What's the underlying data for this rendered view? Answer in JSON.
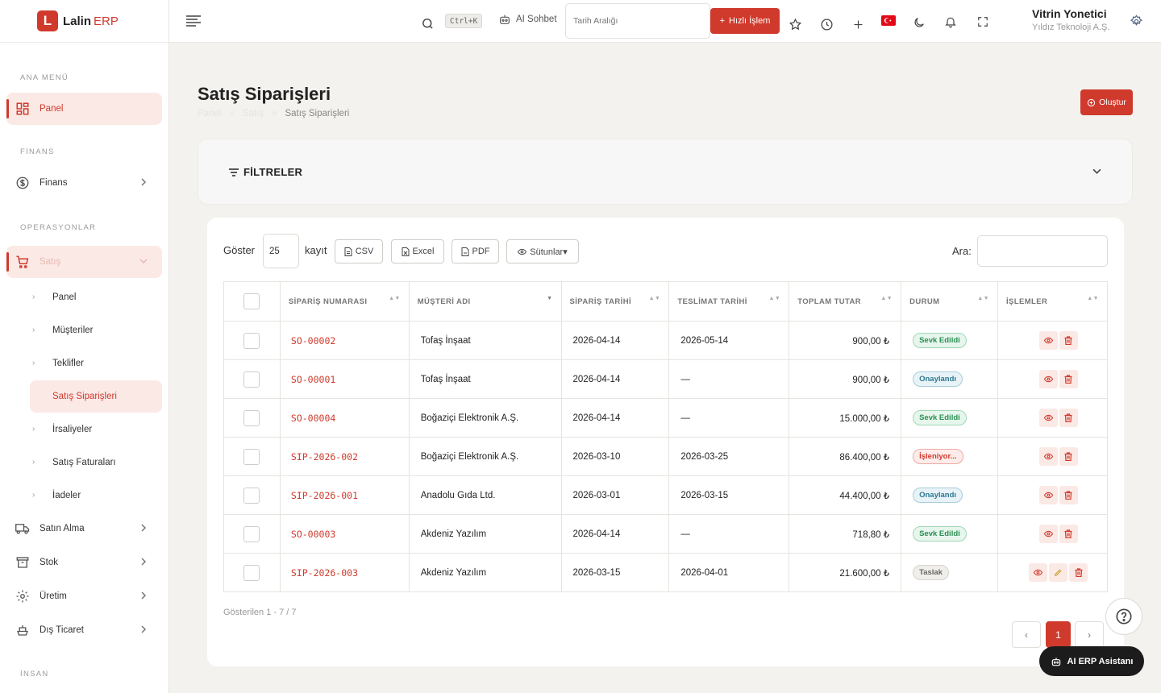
{
  "brand": {
    "logo_letter": "L",
    "name": "Lalin",
    "suffix": "ERP"
  },
  "sidebar": {
    "sections": {
      "main": "ANA MENÜ",
      "finance": "FİNANS",
      "operations": "OPERASYONLAR",
      "human": "İNSAN"
    },
    "items": {
      "panel": "Panel",
      "finance": "Finans",
      "sales": "Satış",
      "purchasing": "Satın Alma",
      "stock": "Stok",
      "production": "Üretim",
      "foreign_trade": "Dış Ticaret"
    },
    "sales_sub": [
      {
        "label": "Panel"
      },
      {
        "label": "Müşteriler"
      },
      {
        "label": "Teklifler"
      },
      {
        "label": "Satış Siparişleri"
      },
      {
        "label": "İrsaliyeler"
      },
      {
        "label": "Satış Faturaları"
      },
      {
        "label": "İadeler"
      }
    ]
  },
  "topbar": {
    "shortcut": "Ctrl+K",
    "ai_chat": "AI Sohbet",
    "date_placeholder": "Tarih Aralığı",
    "quick_action": "Hızlı İşlem",
    "user_name": "Vitrin Yonetici",
    "user_company": "Yıldız Teknoloji A.Ş."
  },
  "page": {
    "title": "Satış Siparişleri",
    "breadcrumb": [
      "Panel",
      "Satış",
      "Satış Siparişleri"
    ],
    "create_label": "Oluştur"
  },
  "filters": {
    "title": "FİLTRELER"
  },
  "toolbar": {
    "show": "Göster",
    "page_size": "25",
    "records": "kayıt",
    "csv": "CSV",
    "excel": "Excel",
    "pdf": "PDF",
    "columns": "Sütunlar▾",
    "search": "Ara:"
  },
  "table": {
    "headers": [
      "SİPARİŞ NUMARASI",
      "MÜŞTERİ ADI",
      "SİPARİŞ TARİHİ",
      "TESLİMAT TARİHİ",
      "TOPLAM TUTAR",
      "DURUM",
      "İŞLEMLER"
    ],
    "rows": [
      {
        "code": "SO-00002",
        "customer": "Tofaş İnşaat",
        "order_date": "2026-04-14",
        "delivery_date": "2026-05-14",
        "total": "900,00 ₺",
        "status": "Sevk Edildi",
        "status_type": "shipped",
        "editable": false
      },
      {
        "code": "SO-00001",
        "customer": "Tofaş İnşaat",
        "order_date": "2026-04-14",
        "delivery_date": "—",
        "total": "900,00 ₺",
        "status": "Onaylandı",
        "status_type": "approved",
        "editable": false
      },
      {
        "code": "SO-00004",
        "customer": "Boğaziçi Elektronik A.Ş.",
        "order_date": "2026-04-14",
        "delivery_date": "—",
        "total": "15.000,00 ₺",
        "status": "Sevk Edildi",
        "status_type": "shipped",
        "editable": false
      },
      {
        "code": "SIP-2026-002",
        "customer": "Boğaziçi Elektronik A.Ş.",
        "order_date": "2026-03-10",
        "delivery_date": "2026-03-25",
        "total": "86.400,00 ₺",
        "status": "İşleniyor...",
        "status_type": "processing",
        "editable": false
      },
      {
        "code": "SIP-2026-001",
        "customer": "Anadolu Gıda Ltd.",
        "order_date": "2026-03-01",
        "delivery_date": "2026-03-15",
        "total": "44.400,00 ₺",
        "status": "Onaylandı",
        "status_type": "approved",
        "editable": false
      },
      {
        "code": "SO-00003",
        "customer": "Akdeniz Yazılım",
        "order_date": "2026-04-14",
        "delivery_date": "—",
        "total": "718,80 ₺",
        "status": "Sevk Edildi",
        "status_type": "shipped",
        "editable": false
      },
      {
        "code": "SIP-2026-003",
        "customer": "Akdeniz Yazılım",
        "order_date": "2026-03-15",
        "delivery_date": "2026-04-01",
        "total": "21.600,00 ₺",
        "status": "Taslak",
        "status_type": "draft",
        "editable": true
      }
    ]
  },
  "pagination": {
    "showing": "Gösterilen 1 - 7 / 7",
    "prev": "‹",
    "current": "1",
    "next": "›"
  },
  "assistant": {
    "label": "AI ERP Asistanı"
  },
  "colors": {
    "accent": "#d03a2c",
    "accent_light": "#fbe9e6",
    "page_bg": "#f3f2ef"
  }
}
